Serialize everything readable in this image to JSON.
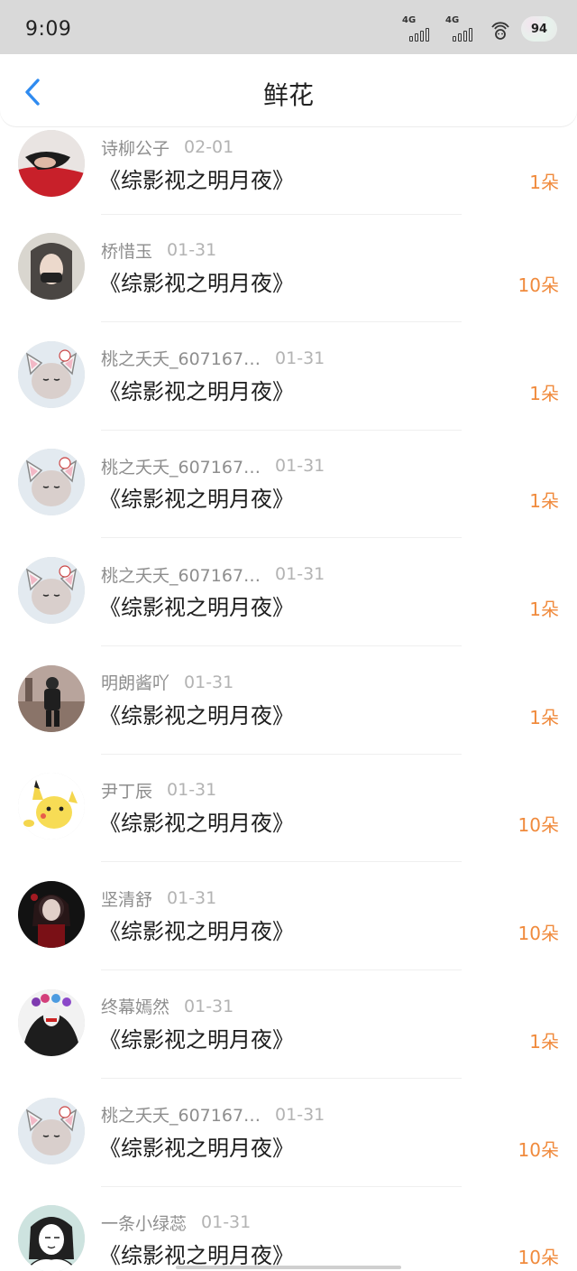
{
  "status_bar": {
    "time": "9:09",
    "signal_1_label": "4G",
    "signal_2_label": "4G",
    "battery": "94"
  },
  "header": {
    "title": "鲜花"
  },
  "colors": {
    "accent_blue": "#2f8bf0",
    "amount_orange": "#f08a3c"
  },
  "items": [
    {
      "name": "诗柳公子",
      "date": "02-01",
      "book": "《综影视之明月夜》",
      "amount": "1朵",
      "avatar": "photo-girl-red"
    },
    {
      "name": "桥惜玉",
      "date": "01-31",
      "book": "《综影视之明月夜》",
      "amount": "10朵",
      "avatar": "photo-masked-girl"
    },
    {
      "name": "桃之夭夭_607167…",
      "date": "01-31",
      "book": "《综影视之明月夜》",
      "amount": "1朵",
      "avatar": "cat-ears-toy"
    },
    {
      "name": "桃之夭夭_607167…",
      "date": "01-31",
      "book": "《综影视之明月夜》",
      "amount": "1朵",
      "avatar": "cat-ears-toy"
    },
    {
      "name": "桃之夭夭_607167…",
      "date": "01-31",
      "book": "《综影视之明月夜》",
      "amount": "1朵",
      "avatar": "cat-ears-toy"
    },
    {
      "name": "明朗酱吖",
      "date": "01-31",
      "book": "《综影视之明月夜》",
      "amount": "1朵",
      "avatar": "photo-street-figure"
    },
    {
      "name": "尹丁辰",
      "date": "01-31",
      "book": "《综影视之明月夜》",
      "amount": "10朵",
      "avatar": "pikachu"
    },
    {
      "name": "坚清舒",
      "date": "01-31",
      "book": "《综影视之明月夜》",
      "amount": "10朵",
      "avatar": "dark-doll"
    },
    {
      "name": "终幕嫣然",
      "date": "01-31",
      "book": "《综影视之明月夜》",
      "amount": "1朵",
      "avatar": "dark-flower-crown"
    },
    {
      "name": "桃之夭夭_607167…",
      "date": "01-31",
      "book": "《综影视之明月夜》",
      "amount": "10朵",
      "avatar": "cat-ears-toy"
    },
    {
      "name": "一条小绿蕊",
      "date": "01-31",
      "book": "《综影视之明月夜》",
      "amount": "10朵",
      "avatar": "sketch-girl"
    }
  ]
}
